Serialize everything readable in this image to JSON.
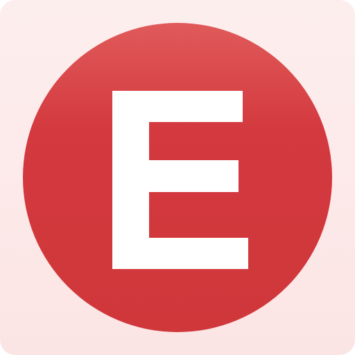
{
  "app_icon": {
    "letter": "E",
    "colors": {
      "background": "#fdeaea",
      "circle_top": "#e05a5a",
      "circle_main": "#d2393e",
      "circle_bottom": "#cf373b",
      "letter": "#ffffff"
    }
  }
}
